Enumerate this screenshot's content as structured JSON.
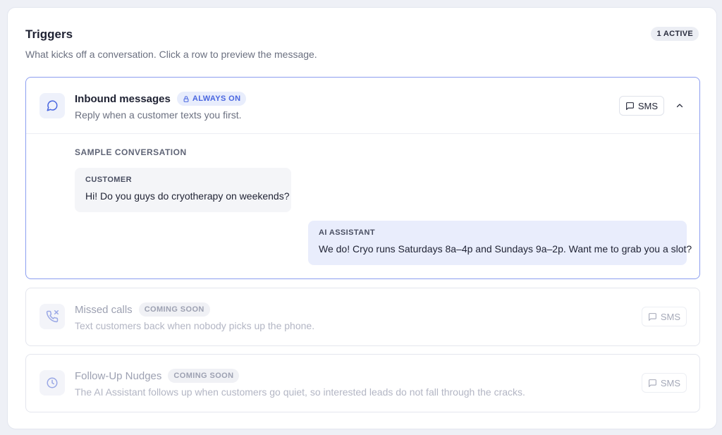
{
  "header": {
    "title": "Triggers",
    "subtitle": "What kicks off a conversation. Click a row to preview the message.",
    "active_count": "1 ACTIVE"
  },
  "triggers": [
    {
      "title": "Inbound messages",
      "badge": "ALWAYS ON",
      "description": "Reply when a customer texts you first.",
      "channel": "SMS",
      "icon": "chat-bubble-icon",
      "expanded": true,
      "sample": {
        "label": "SAMPLE CONVERSATION",
        "messages": [
          {
            "speaker": "CUSTOMER",
            "text": "Hi! Do you guys do cryotherapy on weekends?"
          },
          {
            "speaker": "AI ASSISTANT",
            "text": "We do! Cryo runs Saturdays 8a–4p and Sundays 9a–2p. Want me to grab you a slot?"
          }
        ]
      }
    },
    {
      "title": "Missed calls",
      "badge": "COMING SOON",
      "description": "Text customers back when nobody picks up the phone.",
      "channel": "SMS",
      "icon": "phone-missed-icon"
    },
    {
      "title": "Follow-Up Nudges",
      "badge": "COMING SOON",
      "description": "The AI Assistant follows up when customers go quiet, so interested leads do not fall through the cracks.",
      "channel": "SMS",
      "icon": "clock-icon"
    }
  ],
  "colors": {
    "accent": "#4966e0",
    "accent_border": "#8c9ef0",
    "ai_bubble": "#e9edfc",
    "customer_bubble": "#f4f5f8"
  }
}
